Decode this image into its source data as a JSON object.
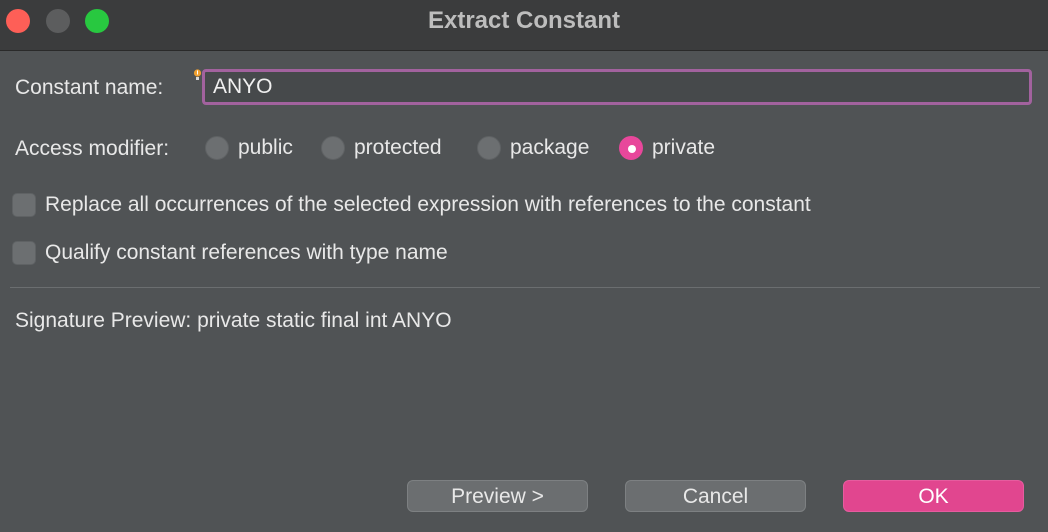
{
  "window": {
    "title": "Extract Constant"
  },
  "form": {
    "name_label": "Constant name:",
    "name_value": "ANYO",
    "access_label": "Access modifier:",
    "access_options": [
      {
        "label": "public",
        "checked": false
      },
      {
        "label": "protected",
        "checked": false
      },
      {
        "label": "package",
        "checked": false
      },
      {
        "label": "private",
        "checked": true
      }
    ],
    "replace_all_label": "Replace all occurrences of the selected expression with references to the constant",
    "replace_all_checked": false,
    "qualify_label": "Qualify constant references with type name",
    "qualify_checked": false
  },
  "signature": {
    "text": "Signature Preview: private static final int ANYO"
  },
  "buttons": {
    "preview": "Preview >",
    "cancel": "Cancel",
    "ok": "OK"
  },
  "colors": {
    "accent": "#e1468f",
    "focus_border": "#a2629e",
    "background": "#505355"
  }
}
